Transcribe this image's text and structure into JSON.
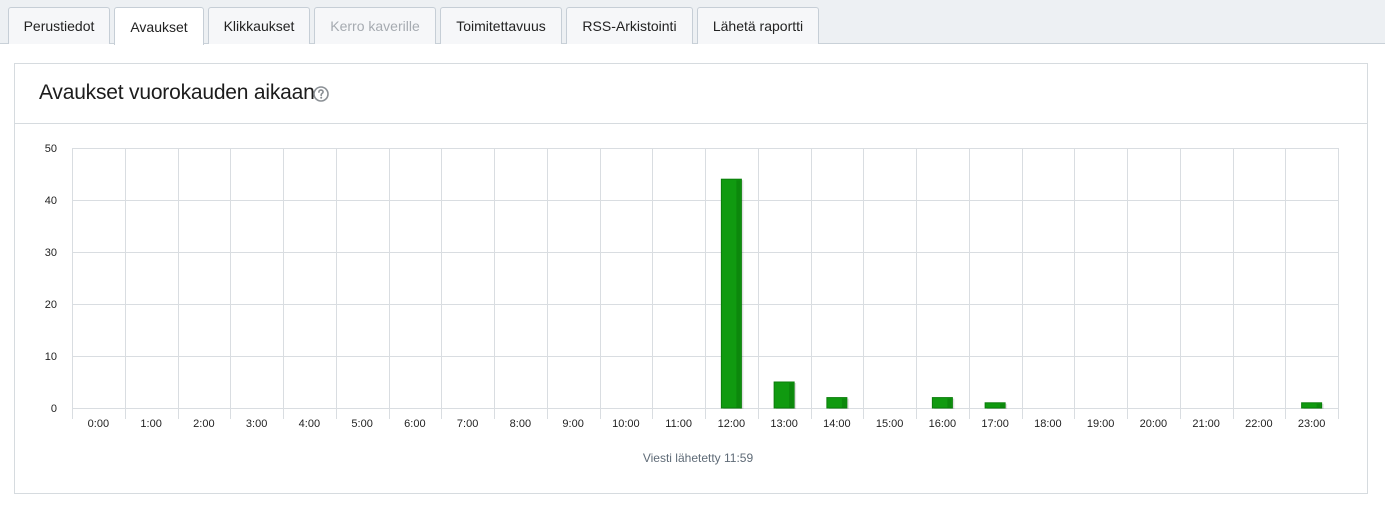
{
  "tabs": [
    {
      "label": "Perustiedot",
      "state": "normal"
    },
    {
      "label": "Avaukset",
      "state": "active"
    },
    {
      "label": "Klikkaukset",
      "state": "normal"
    },
    {
      "label": "Kerro kaverille",
      "state": "disabled"
    },
    {
      "label": "Toimitettavuus",
      "state": "normal"
    },
    {
      "label": "RSS-Arkistointi",
      "state": "normal"
    },
    {
      "label": "Lähetä raportti",
      "state": "normal"
    }
  ],
  "panel": {
    "title": "Avaukset vuorokauden aikaan",
    "help_icon": "question-circle-icon"
  },
  "colors": {
    "bar": "#109a10",
    "bar_dark": "#0a7d0a",
    "grid": "#d9dde1"
  },
  "chart_data": {
    "type": "bar",
    "categories": [
      "0:00",
      "1:00",
      "2:00",
      "3:00",
      "4:00",
      "5:00",
      "6:00",
      "7:00",
      "8:00",
      "9:00",
      "10:00",
      "11:00",
      "12:00",
      "13:00",
      "14:00",
      "15:00",
      "16:00",
      "17:00",
      "18:00",
      "19:00",
      "20:00",
      "21:00",
      "22:00",
      "23:00"
    ],
    "values": [
      0,
      0,
      0,
      0,
      0,
      0,
      0,
      0,
      0,
      0,
      0,
      0,
      44,
      5,
      2,
      0,
      2,
      1,
      0,
      0,
      0,
      0,
      0,
      1
    ],
    "yticks": [
      0,
      10,
      20,
      30,
      40,
      50
    ],
    "ylim": [
      0,
      50
    ],
    "xnote": "Viesti lähetetty 11:59",
    "grid": true
  }
}
